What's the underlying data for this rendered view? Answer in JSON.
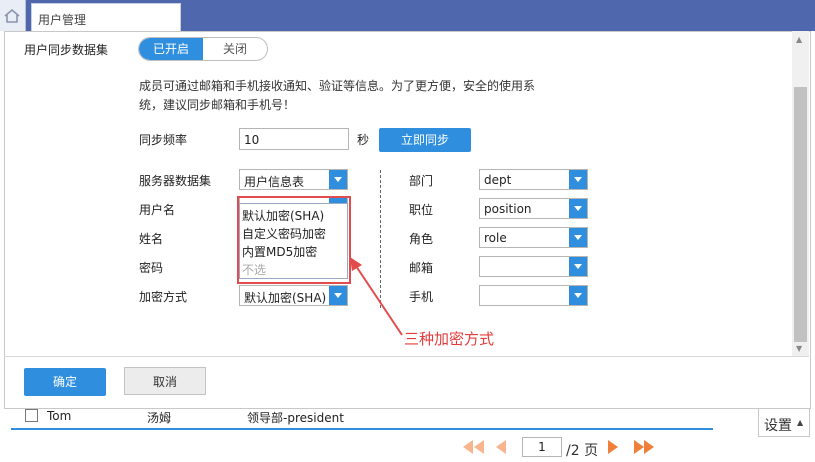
{
  "tab": {
    "title": "用户管理"
  },
  "sync": {
    "label": "用户同步数据集",
    "on_label": "已开启",
    "off_label": "关闭",
    "description_line1": "成员可通过邮箱和手机接收通知、验证等信息。为了更方便，安全的使用系",
    "description_line2": "统，建议同步邮箱和手机号！",
    "frequency_label": "同步频率",
    "frequency_value": "10",
    "frequency_unit": "秒",
    "sync_now_label": "立即同步"
  },
  "left_fields": {
    "server_dataset_label": "服务器数据集",
    "server_dataset_value": "用户信息表",
    "username_label": "用户名",
    "name_label": "姓名",
    "password_label": "密码",
    "encryption_label": "加密方式",
    "encryption_value": "默认加密(SHA)"
  },
  "right_fields": {
    "dept_label": "部门",
    "dept_value": "dept",
    "position_label": "职位",
    "position_value": "position",
    "role_label": "角色",
    "role_value": "role",
    "email_label": "邮箱",
    "email_value": "",
    "phone_label": "手机",
    "phone_value": ""
  },
  "dropdown": {
    "options": [
      "默认加密(SHA)",
      "自定义密码加密",
      "内置MD5加密",
      "不选"
    ]
  },
  "annotation": {
    "text": "三种加密方式",
    "color": "#e24c4c"
  },
  "footer": {
    "ok_label": "确定",
    "cancel_label": "取消"
  },
  "table_row": {
    "username": "Tom",
    "name": "汤姆",
    "dept": "领导部-president"
  },
  "settings": {
    "label": "设置"
  },
  "pager": {
    "current_page": "1",
    "total_text": "/2 页"
  },
  "colors": {
    "accent": "#2f8fde",
    "topbar": "#4f67ad",
    "pager": "#f07f3a"
  }
}
